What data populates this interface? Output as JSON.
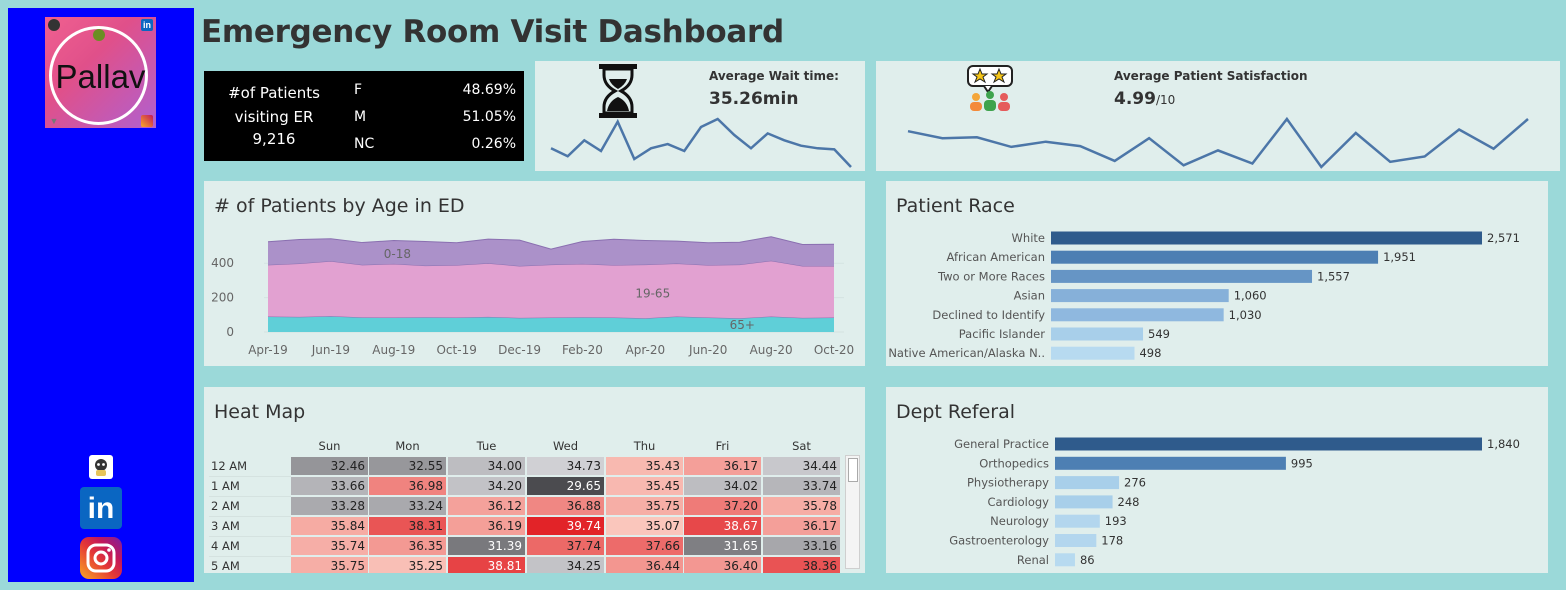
{
  "sidebar": {
    "logo_text": "Pallav",
    "links": [
      "github-icon",
      "linkedin-icon",
      "instagram-icon"
    ],
    "linkedin_text": "in"
  },
  "title": "Emergency Room Visit Dashboard",
  "patients_kpi": {
    "label_line1": "#of Patients",
    "label_line2": "visiting ER",
    "total": "9,216",
    "genders": [
      {
        "label": "F",
        "pct": "48.69%"
      },
      {
        "label": "M",
        "pct": "51.05%"
      },
      {
        "label": "NC",
        "pct": "0.26%"
      }
    ]
  },
  "wait_kpi": {
    "label": "Average Wait time:",
    "value": "35.26min",
    "sparkline": [
      35.0,
      33.5,
      36.5,
      34.5,
      40.0,
      33.0,
      35.0,
      35.8,
      34.5,
      39.0,
      40.5,
      37.5,
      35.0,
      37.8,
      36.5,
      35.5,
      35.0,
      34.8,
      31.5
    ]
  },
  "satisfaction_kpi": {
    "label": "Average Patient Satisfaction",
    "value": "4.99",
    "unit": "/10",
    "sparkline": [
      5.3,
      4.9,
      4.95,
      4.4,
      4.7,
      4.45,
      3.6,
      4.9,
      3.35,
      4.2,
      3.45,
      6.0,
      3.25,
      5.2,
      3.55,
      3.85,
      5.4,
      4.3,
      6.0
    ]
  },
  "age_chart": {
    "title": "# of Patients by Age in ED",
    "chart_data": {
      "type": "area",
      "x": [
        "Apr-19",
        "May-19",
        "Jun-19",
        "Jul-19",
        "Aug-19",
        "Sep-19",
        "Oct-19",
        "Nov-19",
        "Dec-19",
        "Jan-20",
        "Feb-20",
        "Mar-20",
        "Apr-20",
        "May-20",
        "Jun-20",
        "Jul-20",
        "Aug-20",
        "Sep-20",
        "Oct-20"
      ],
      "x_ticks": [
        "Apr-19",
        "Jun-19",
        "Aug-19",
        "Oct-19",
        "Dec-19",
        "Feb-20",
        "Apr-20",
        "Jun-20",
        "Aug-20",
        "Oct-20"
      ],
      "y_ticks": [
        "0",
        "200",
        "400"
      ],
      "ylim": [
        0,
        560
      ],
      "series": [
        {
          "name": "65+",
          "color": "#5fcfd8",
          "values": [
            90,
            88,
            92,
            85,
            84,
            86,
            84,
            88,
            82,
            84,
            86,
            84,
            80,
            90,
            84,
            80,
            90,
            82,
            84
          ]
        },
        {
          "name": "19-65",
          "color": "#e2a1d1",
          "values": [
            300,
            310,
            320,
            305,
            312,
            300,
            305,
            312,
            302,
            308,
            310,
            305,
            312,
            308,
            305,
            312,
            324,
            302,
            300
          ]
        },
        {
          "name": "0-18",
          "color": "#ab91c9",
          "values": [
            135,
            140,
            130,
            130,
            136,
            140,
            130,
            140,
            150,
            90,
            130,
            150,
            140,
            130,
            130,
            130,
            140,
            125,
            126
          ]
        }
      ]
    }
  },
  "race_chart": {
    "title": "Patient Race",
    "chart_data": {
      "type": "bar",
      "categories": [
        "White",
        "African American",
        "Two or More Races",
        "Asian",
        "Declined to Identify",
        "Pacific Islander",
        "Native American/Alaska N.."
      ],
      "values": [
        2571,
        1951,
        1557,
        1060,
        1030,
        549,
        498
      ],
      "labels": [
        "2,571",
        "1,951",
        "1,557",
        "1,060",
        "1,030",
        "549",
        "498"
      ],
      "colors": [
        "#2f5b8c",
        "#4d7fb3",
        "#6695c5",
        "#86b0d9",
        "#8fb8df",
        "#a8cfea",
        "#b7daf0"
      ]
    }
  },
  "heat_map": {
    "title": "Heat Map",
    "days": [
      "Sun",
      "Mon",
      "Tue",
      "Wed",
      "Thu",
      "Fri",
      "Sat"
    ],
    "hours": [
      "12 AM",
      "1 AM",
      "2 AM",
      "3 AM",
      "4 AM",
      "5 AM"
    ],
    "values": [
      [
        "32.46",
        "32.55",
        "34.00",
        "34.73",
        "35.43",
        "36.17",
        "34.44"
      ],
      [
        "33.66",
        "36.98",
        "34.20",
        "29.65",
        "35.45",
        "34.02",
        "33.74"
      ],
      [
        "33.28",
        "33.24",
        "36.12",
        "36.88",
        "35.75",
        "37.20",
        "35.78"
      ],
      [
        "35.84",
        "38.31",
        "36.19",
        "39.74",
        "35.07",
        "38.67",
        "36.17"
      ],
      [
        "35.74",
        "36.35",
        "31.39",
        "37.74",
        "37.66",
        "31.65",
        "33.16"
      ],
      [
        "35.75",
        "35.25",
        "38.81",
        "34.25",
        "36.44",
        "36.40",
        "38.36"
      ]
    ]
  },
  "dept_chart": {
    "title": "Dept Referal",
    "chart_data": {
      "type": "bar",
      "categories": [
        "General Practice",
        "Orthopedics",
        "Physiotherapy",
        "Cardiology",
        "Neurology",
        "Gastroenterology",
        "Renal"
      ],
      "values": [
        1840,
        995,
        276,
        248,
        193,
        178,
        86
      ],
      "labels": [
        "1,840",
        "995",
        "276",
        "248",
        "193",
        "178",
        "86"
      ],
      "colors": [
        "#2f5b8c",
        "#4d7fb3",
        "#a8cfea",
        "#a8cfea",
        "#b3d6ee",
        "#b3d6ee",
        "#b7daf0"
      ]
    }
  }
}
